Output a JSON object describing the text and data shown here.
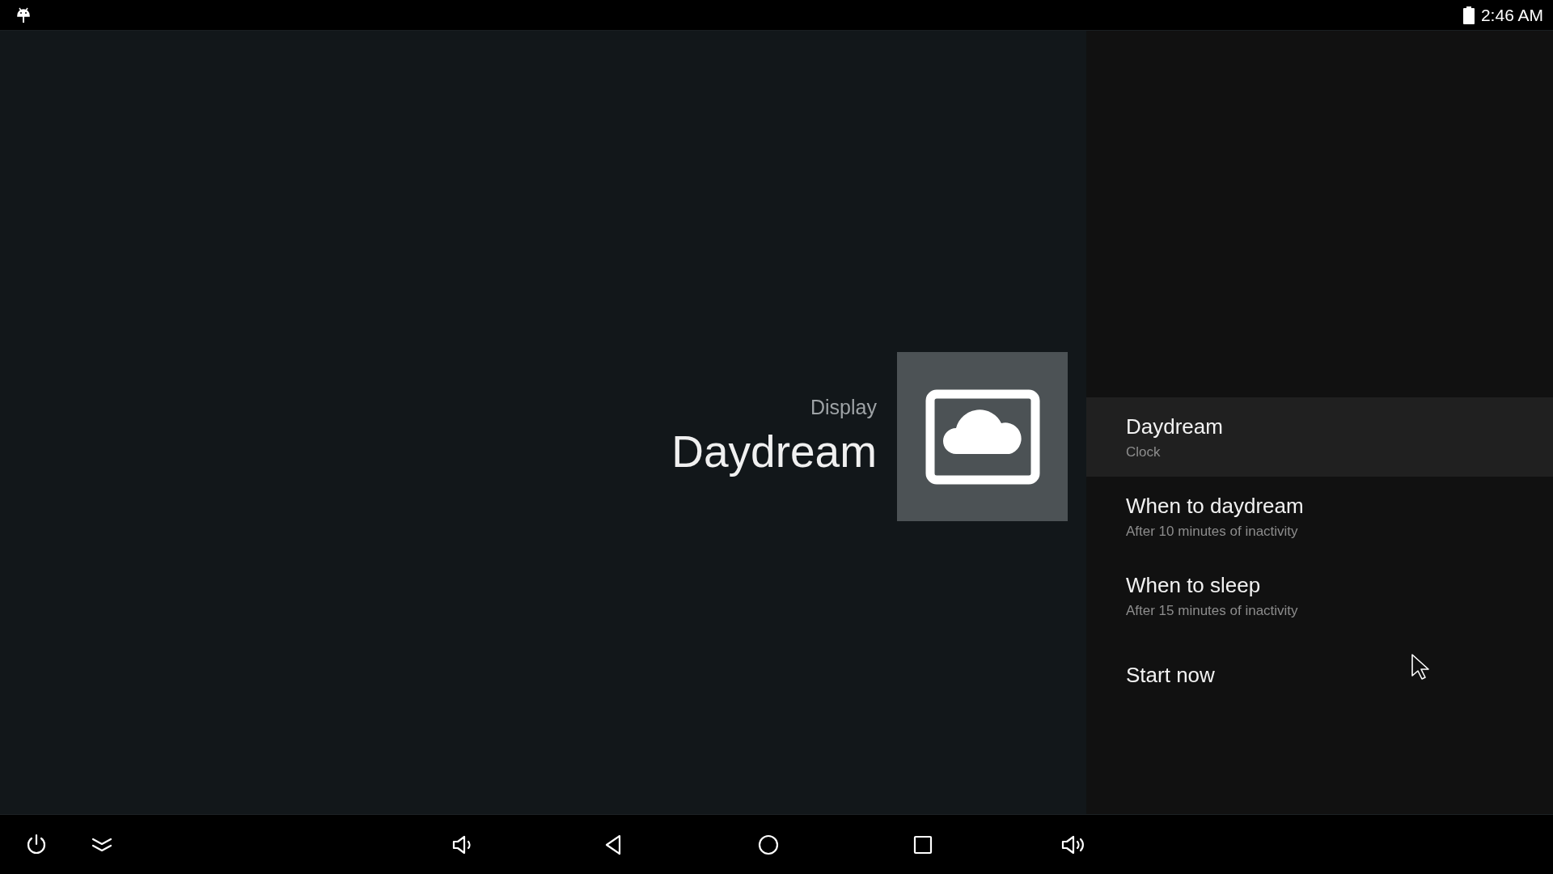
{
  "status_bar": {
    "time": "2:46 AM"
  },
  "header": {
    "breadcrumb": "Display",
    "title": "Daydream"
  },
  "settings": [
    {
      "title": "Daydream",
      "summary": "Clock",
      "selected": true
    },
    {
      "title": "When to daydream",
      "summary": "After 10 minutes of inactivity",
      "selected": false
    },
    {
      "title": "When to sleep",
      "summary": "After 15 minutes of inactivity",
      "selected": false
    },
    {
      "title": "Start now",
      "selected": false
    }
  ],
  "nav_bar": [
    {
      "kind": "power"
    },
    {
      "kind": "collapse"
    },
    {
      "kind": "volume-down"
    },
    {
      "kind": "back"
    },
    {
      "kind": "home"
    },
    {
      "kind": "recents"
    },
    {
      "kind": "volume-up"
    }
  ]
}
